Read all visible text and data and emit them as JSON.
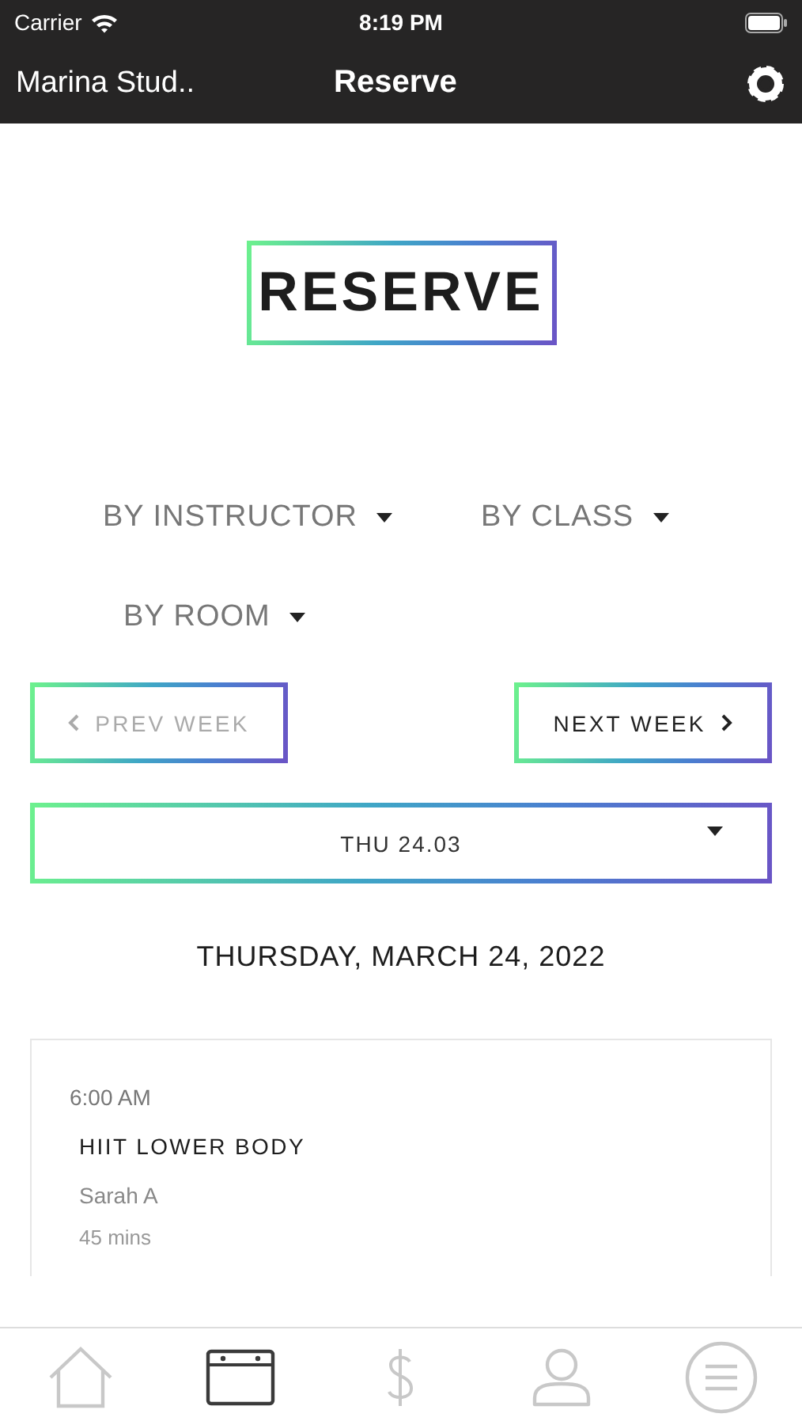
{
  "status_bar": {
    "carrier": "Carrier",
    "time": "8:19 PM"
  },
  "nav_bar": {
    "back_label": "Marina Stud..",
    "title": "Reserve"
  },
  "logo": {
    "text": "RESERVE"
  },
  "filters": [
    {
      "label": "BY INSTRUCTOR"
    },
    {
      "label": "BY CLASS"
    },
    {
      "label": "BY ROOM"
    }
  ],
  "week_nav": [
    {
      "kind": "prev",
      "label": "PREV WEEK",
      "disabled": true
    },
    {
      "kind": "next",
      "label": "NEXT WEEK",
      "disabled": false
    }
  ],
  "date_select": {
    "value": "THU 24.03"
  },
  "day_heading": "THURSDAY, MARCH 24, 2022",
  "classes": [
    {
      "time": "6:00 AM",
      "name": "HIIT LOWER BODY",
      "instructor": "Sarah A",
      "duration": "45 mins"
    }
  ],
  "tab_bar": [
    {
      "kind": "home",
      "selected": false
    },
    {
      "kind": "calendar",
      "selected": true
    },
    {
      "kind": "dollar",
      "selected": false
    },
    {
      "kind": "person",
      "selected": false
    },
    {
      "kind": "menu",
      "selected": false
    }
  ]
}
